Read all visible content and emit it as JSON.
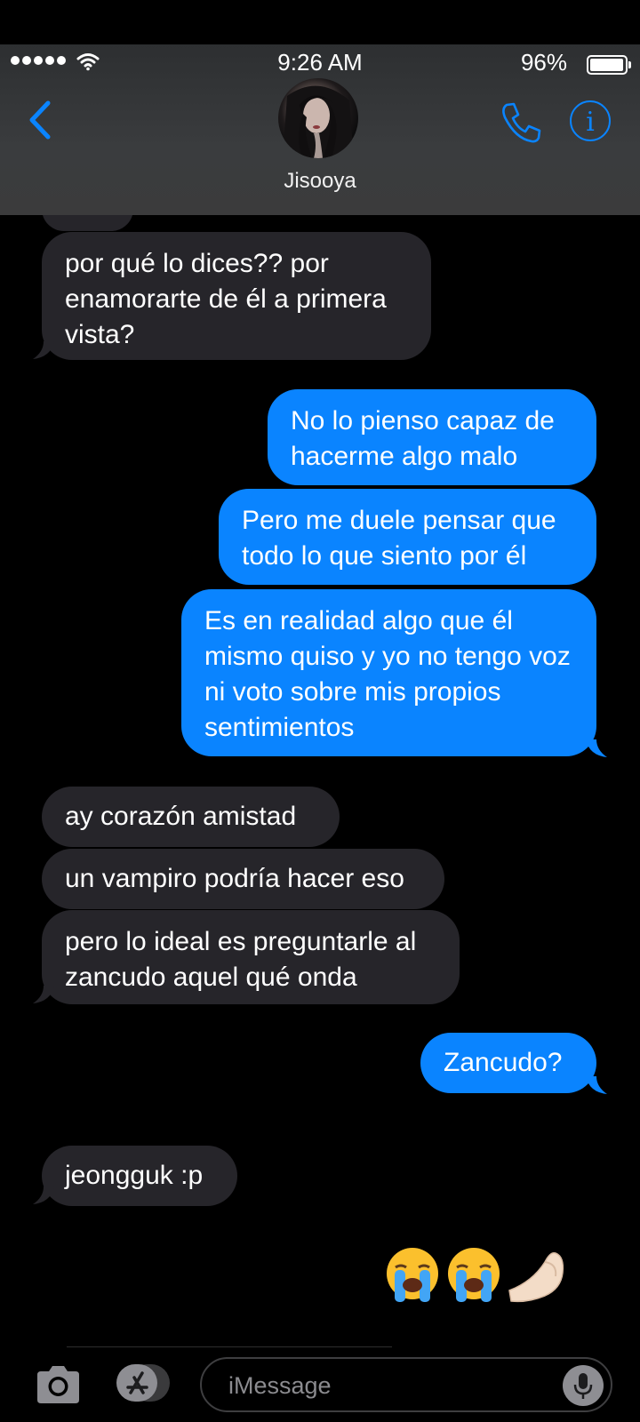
{
  "status": {
    "time": "9:26 AM",
    "battery": "96%"
  },
  "contact": {
    "name": "Jisooya"
  },
  "messages": [
    {
      "side": "in",
      "text": "por qué lo dices?? por enamorarte de él a primera vista?"
    },
    {
      "side": "out",
      "text": "No lo pienso capaz de hacerme algo malo"
    },
    {
      "side": "out",
      "text": "Pero me duele pensar que todo lo que siento por él"
    },
    {
      "side": "out",
      "text": "Es en realidad algo que él mismo quiso y yo no tengo voz ni voto sobre mis propios sentimientos"
    },
    {
      "side": "in",
      "text": "ay corazón amistad"
    },
    {
      "side": "in",
      "text": "un vampiro podría hacer eso"
    },
    {
      "side": "in",
      "text": "pero lo ideal es preguntarle al zancudo aquel qué onda"
    },
    {
      "side": "out",
      "text": "Zancudo?"
    },
    {
      "side": "in",
      "text": "jeongguk :p"
    },
    {
      "side": "out",
      "text": "😭😭🤌🏻"
    }
  ],
  "composer": {
    "placeholder": "iMessage"
  },
  "icons": [
    "signal-dots-icon",
    "wifi-icon",
    "battery-icon",
    "back-chevron-icon",
    "phone-icon",
    "info-icon",
    "camera-icon",
    "app-store-icon",
    "microphone-icon"
  ],
  "colors": {
    "outgoing": "#0a84ff",
    "incoming": "#26252a",
    "accent": "#0a84ff"
  }
}
